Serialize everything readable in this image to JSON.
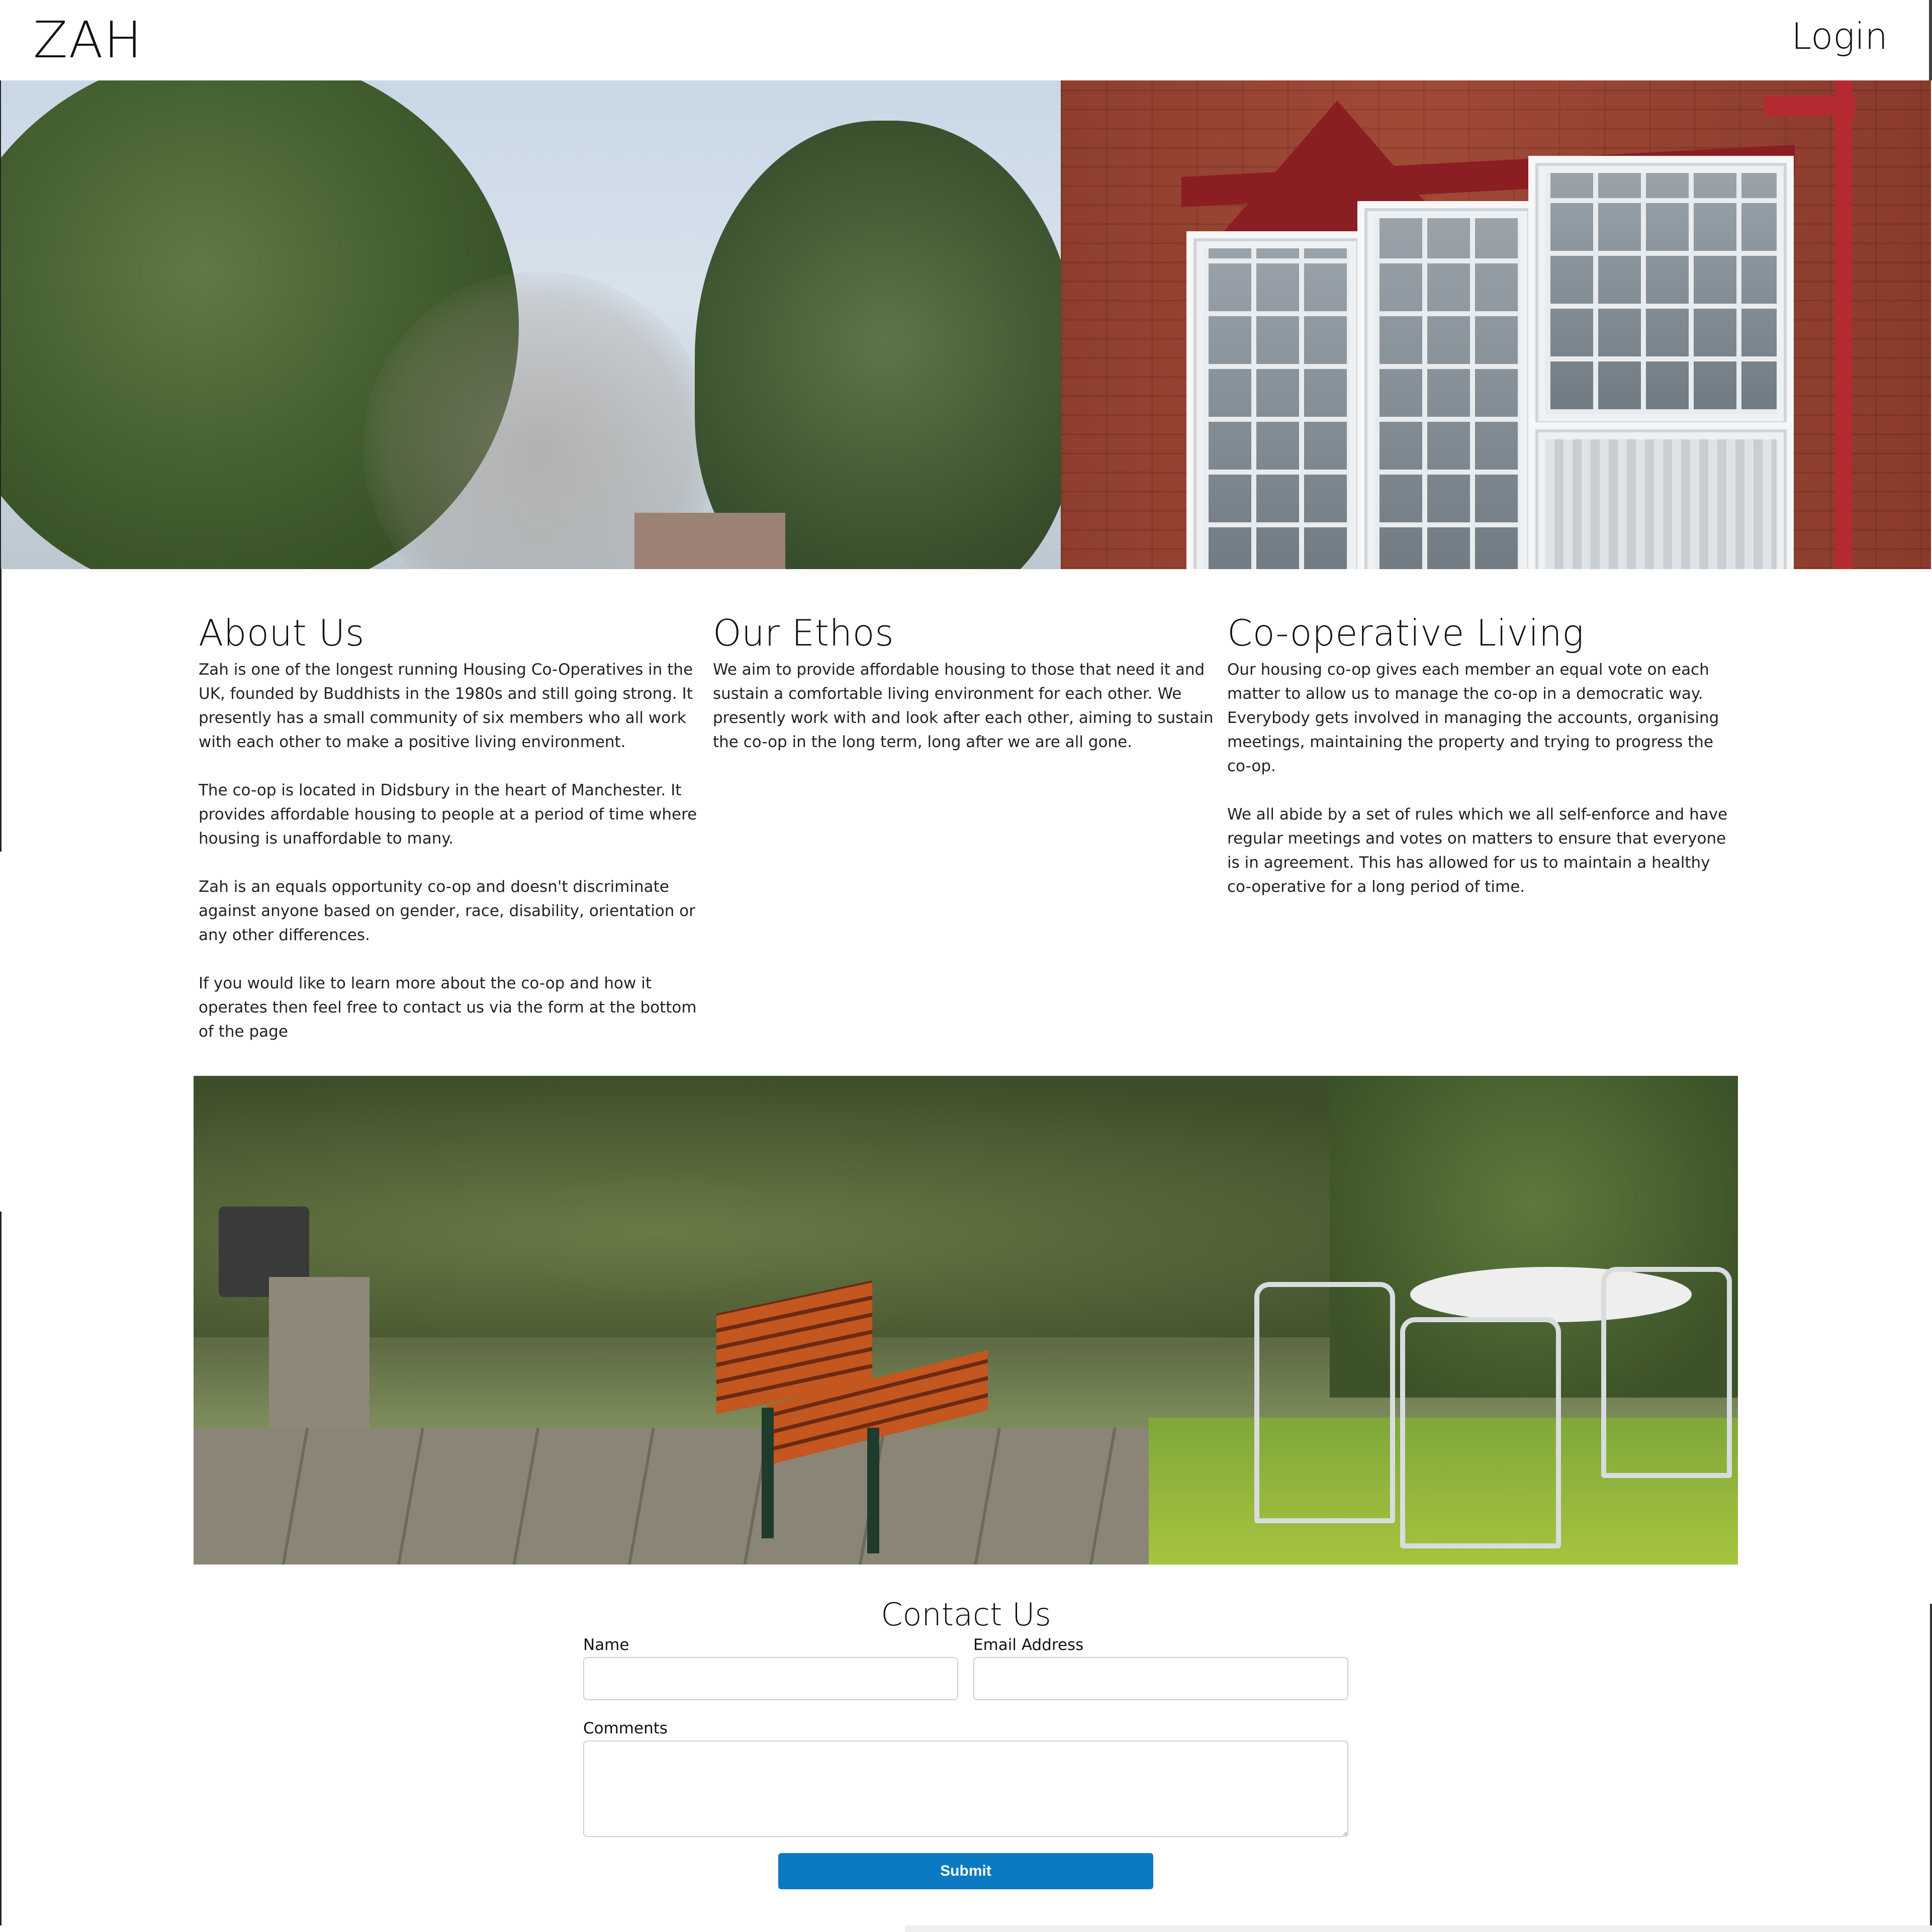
{
  "header": {
    "brand": "ZAH",
    "login_label": "Login"
  },
  "sections": {
    "about": {
      "title": "About Us",
      "paragraphs": [
        "Zah is one of the longest running Housing Co-Operatives in the UK, founded by Buddhists in the 1980s and still going strong. It presently has a small community of six members who all work with each other to make a positive living environment.",
        "The co-op is located in Didsbury in the heart of Manchester. It provides affordable housing to people at a period of time where housing is unaffordable to many.",
        "Zah is an equals opportunity co-op and doesn't discriminate against anyone based on gender, race, disability, orientation or any other differences.",
        "If you would like to learn more about the co-op and how it operates then feel free to contact us via the form at the bottom of the page"
      ]
    },
    "ethos": {
      "title": "Our Ethos",
      "paragraphs": [
        "We aim to provide affordable housing to those that need it and sustain a comfortable living environment for each other. We presently work with and look after each other, aiming to sustain the co-op in the long term, long after we are all gone."
      ]
    },
    "living": {
      "title": "Co-operative Living",
      "paragraphs": [
        "Our housing co-op gives each member an equal vote on each matter to allow us to manage the co-op in a democratic way. Everybody gets involved in managing the accounts, organising meetings, maintaining the property and trying to progress the co-op.",
        "We all abide by a set of rules which we all self-enforce and have regular meetings and votes on matters to ensure that everyone is in agreement. This has allowed for us to maintain a healthy co-operative for a long period of time."
      ]
    }
  },
  "contact": {
    "title": "Contact Us",
    "name_label": "Name",
    "name_value": "",
    "email_label": "Email Address",
    "email_value": "",
    "comments_label": "Comments",
    "comments_value": "",
    "submit_label": "Submit"
  },
  "colors": {
    "submit_button": "#0b7ac3",
    "brick": "#a04a36",
    "window_trim": "#8b1e22"
  }
}
